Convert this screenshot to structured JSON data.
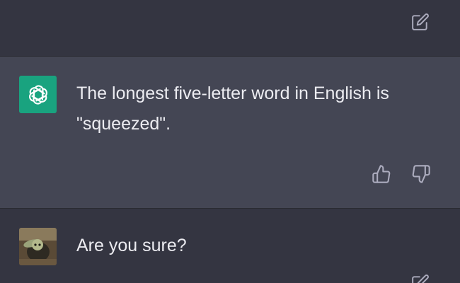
{
  "assistant_message": {
    "text": "The longest five-letter word in English is \"squeezed\".",
    "avatar_icon": "openai-logo-icon",
    "avatar_color": "#19a37f"
  },
  "user_message": {
    "text": "Are you sure?",
    "avatar_icon": "user-avatar-image"
  },
  "icons": {
    "edit": "edit-icon",
    "thumbs_up": "thumbs-up-icon",
    "thumbs_down": "thumbs-down-icon"
  },
  "colors": {
    "background": "#343541",
    "assistant_background": "#444654",
    "text": "#ececf1",
    "icon": "#acacbe"
  }
}
